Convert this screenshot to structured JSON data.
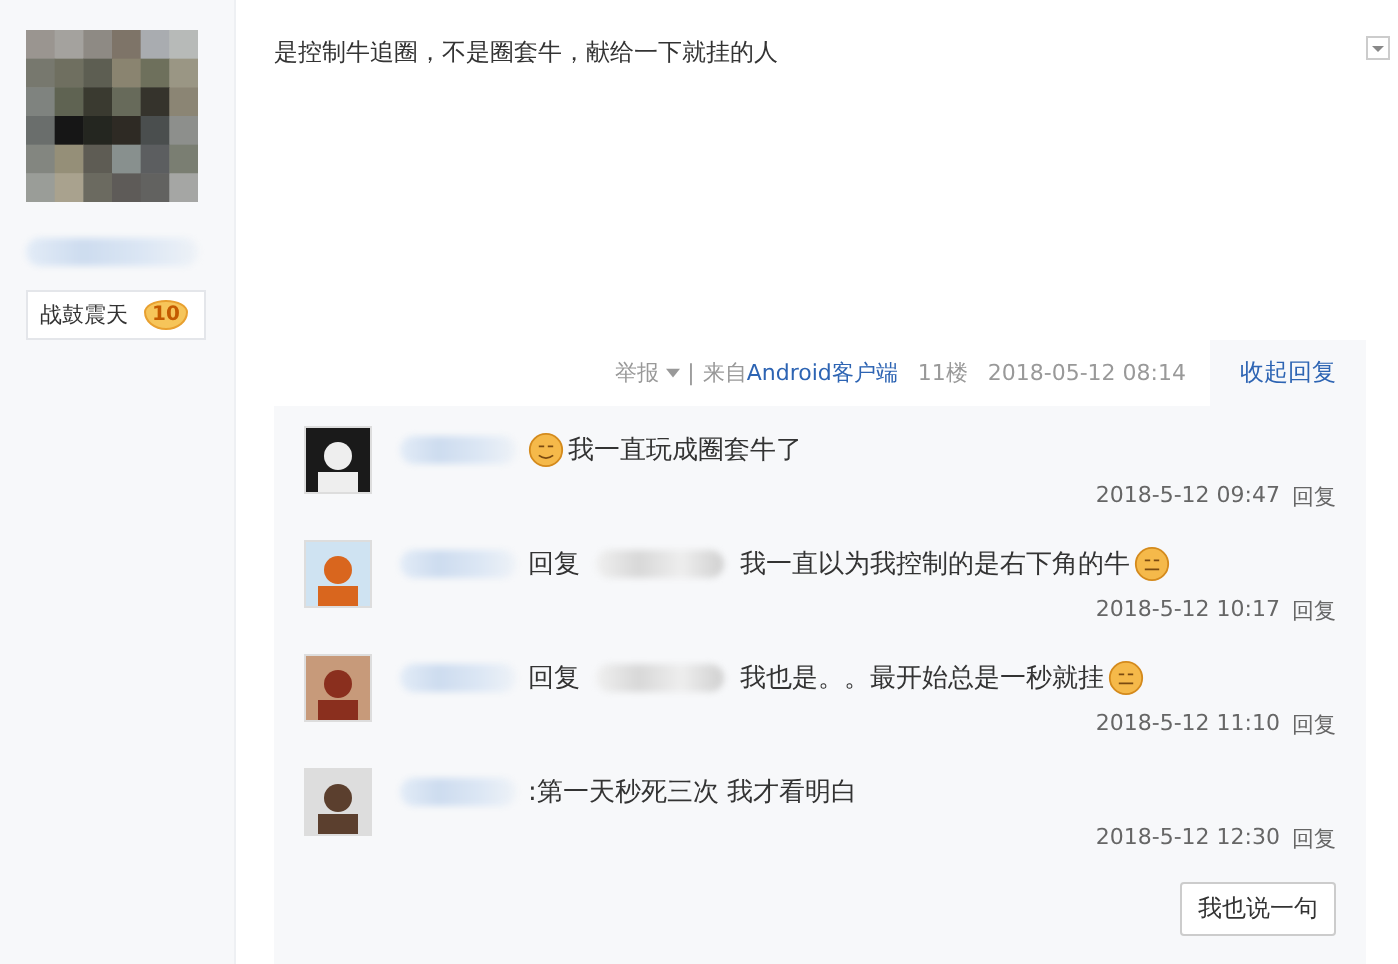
{
  "author": {
    "badge": {
      "title": "战鼓震天",
      "level": "10"
    }
  },
  "post": {
    "content": "是控制牛追圈，不是圈套牛，献给一下就挂的人"
  },
  "post_footer": {
    "report": "举报",
    "separator": "|",
    "source_prefix": "来自",
    "source_link": "Android客户端",
    "floor": "11楼",
    "time": "2018-05-12 08:14",
    "collapse": "收起回复"
  },
  "replies": [
    {
      "content": "我一直玩成圈套牛了",
      "emoji_before": true,
      "emoji_after": false,
      "time": "2018-5-12 09:47",
      "action": "回复"
    },
    {
      "reply_label": "回复",
      "content": "我一直以为我控制的是右下角的牛",
      "emoji_before": false,
      "emoji_after": true,
      "time": "2018-5-12 10:17",
      "action": "回复"
    },
    {
      "reply_label": "回复",
      "content": "我也是。。最开始总是一秒就挂",
      "emoji_before": false,
      "emoji_after": true,
      "time": "2018-5-12 11:10",
      "action": "回复"
    },
    {
      "content": ":第一天秒死三次 我才看明白",
      "emoji_before": false,
      "emoji_after": false,
      "time": "2018-5-12 12:30",
      "action": "回复"
    }
  ],
  "say_button": "我也说一句"
}
